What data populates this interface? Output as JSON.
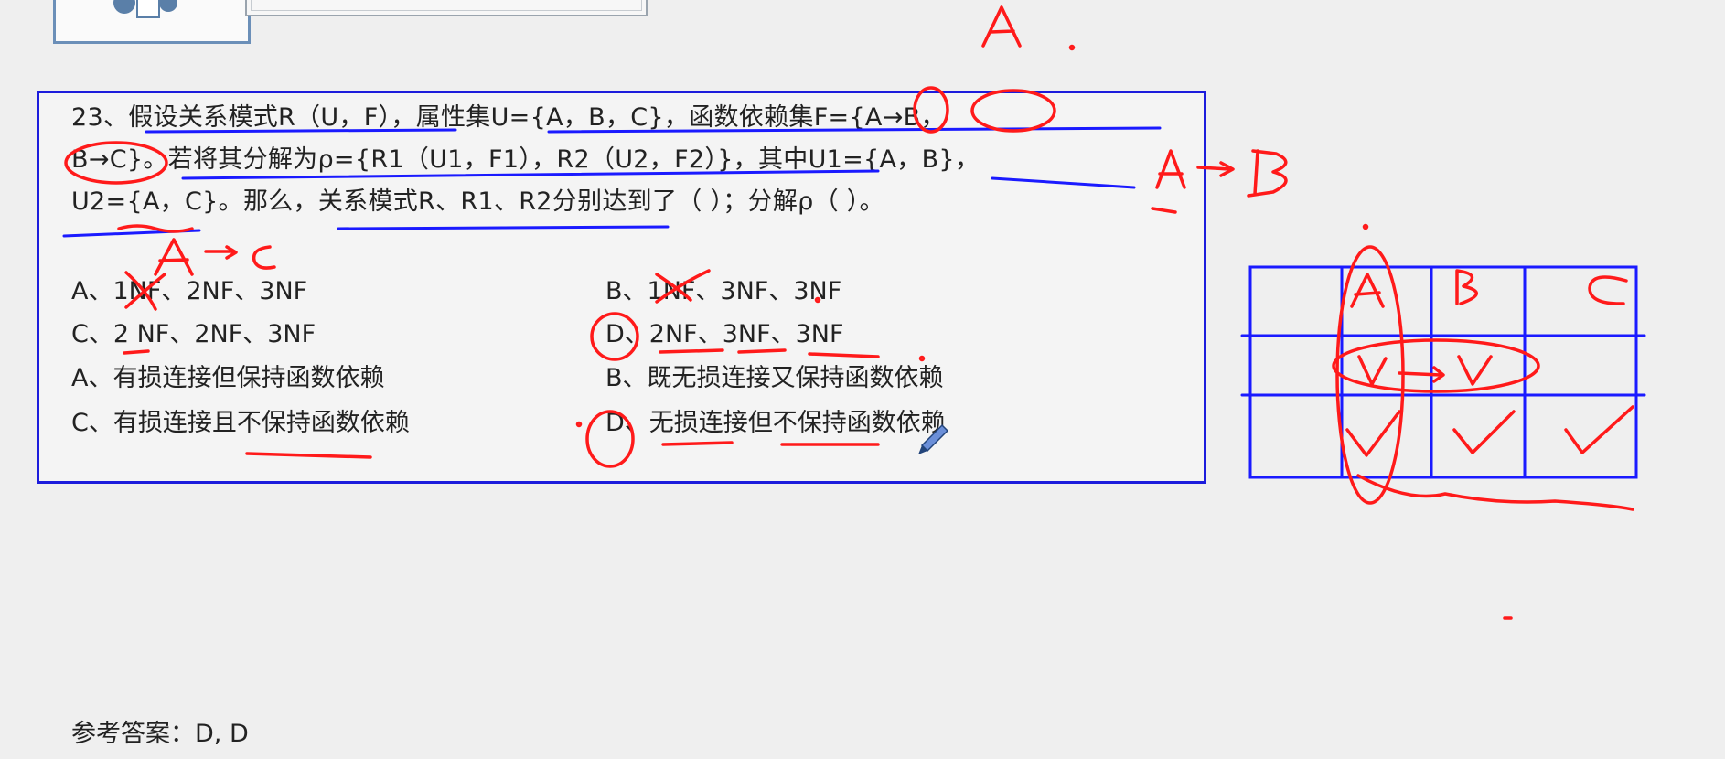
{
  "question": {
    "line1": "23、假设关系模式R（U，F），属性集U={A，B，C}，函数依赖集F={A→B，",
    "line2": "B→C}。若将其分解为ρ={R1（U1，F1），R2（U2，F2）}，其中U1={A，B}，",
    "line3": "U2={A，C}。那么，关系模式R、R1、R2分别达到了（  ）；分解ρ（  ）。"
  },
  "options_nf": [
    {
      "id": "A",
      "text": "A、1NF、2NF、3NF"
    },
    {
      "id": "B",
      "text": "B、1NF、3NF、3NF"
    },
    {
      "id": "C",
      "text": "C、2 NF、2NF、3NF"
    },
    {
      "id": "D",
      "text": "D、2NF、3NF、3NF"
    }
  ],
  "options_decomp": [
    {
      "id": "A",
      "text": "A、有损连接但保持函数依赖"
    },
    {
      "id": "B",
      "text": "B、既无损连接又保持函数依赖"
    },
    {
      "id": "C",
      "text": "C、有损连接且不保持函数依赖"
    },
    {
      "id": "D",
      "text": "D、无损连接但不保持函数依赖"
    }
  ],
  "answer": "参考答案：D, D",
  "colors": {
    "box_border": "#1c1cdc",
    "ink_red": "#ff1a1a",
    "ink_blue": "#1a1aff"
  }
}
